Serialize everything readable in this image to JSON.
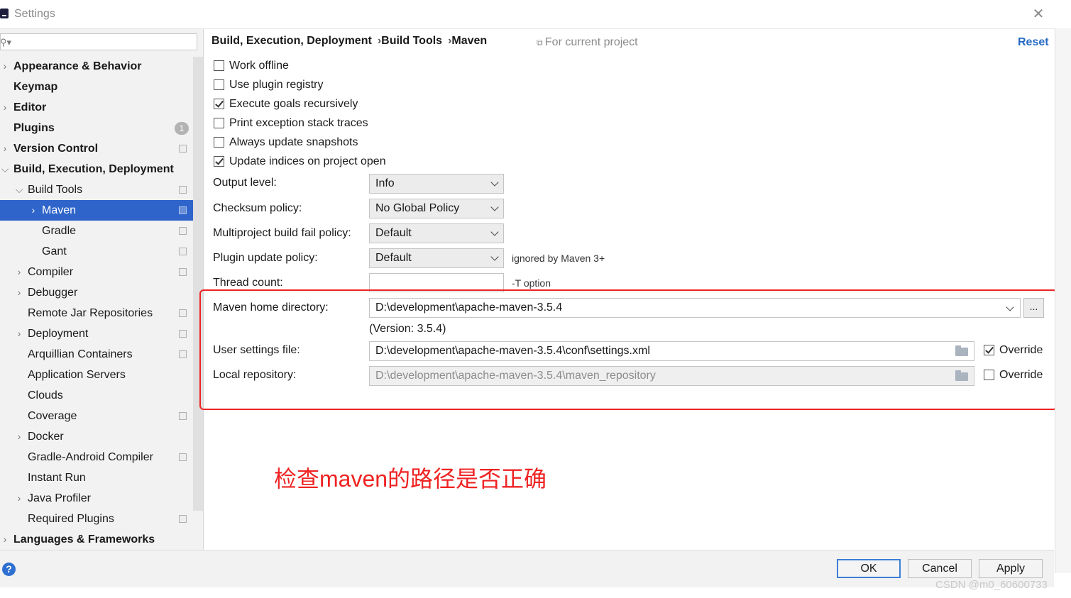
{
  "window": {
    "title": "Settings",
    "close_icon": "close-icon"
  },
  "search": {
    "placeholder": ""
  },
  "tree": [
    {
      "label": "Appearance & Behavior",
      "bold": true,
      "arrow": "›",
      "indent": 0,
      "proj": false
    },
    {
      "label": "Keymap",
      "bold": true,
      "arrow": "",
      "indent": 0,
      "proj": false
    },
    {
      "label": "Editor",
      "bold": true,
      "arrow": "›",
      "indent": 0,
      "proj": false
    },
    {
      "label": "Plugins",
      "bold": true,
      "arrow": "",
      "indent": 0,
      "proj": false,
      "badge": "1"
    },
    {
      "label": "Version Control",
      "bold": true,
      "arrow": "›",
      "indent": 0,
      "proj": true
    },
    {
      "label": "Build, Execution, Deployment",
      "bold": true,
      "arrow": "⌄",
      "indent": 0,
      "proj": false
    },
    {
      "label": "Build Tools",
      "bold": false,
      "arrow": "⌄",
      "indent": 1,
      "proj": true
    },
    {
      "label": "Maven",
      "bold": false,
      "arrow": "›",
      "indent": 2,
      "proj": true,
      "selected": true
    },
    {
      "label": "Gradle",
      "bold": false,
      "arrow": "",
      "indent": 2,
      "proj": true
    },
    {
      "label": "Gant",
      "bold": false,
      "arrow": "",
      "indent": 2,
      "proj": true
    },
    {
      "label": "Compiler",
      "bold": false,
      "arrow": "›",
      "indent": 1,
      "proj": true
    },
    {
      "label": "Debugger",
      "bold": false,
      "arrow": "›",
      "indent": 1,
      "proj": false
    },
    {
      "label": "Remote Jar Repositories",
      "bold": false,
      "arrow": "",
      "indent": 1,
      "proj": true
    },
    {
      "label": "Deployment",
      "bold": false,
      "arrow": "›",
      "indent": 1,
      "proj": true
    },
    {
      "label": "Arquillian Containers",
      "bold": false,
      "arrow": "",
      "indent": 1,
      "proj": true
    },
    {
      "label": "Application Servers",
      "bold": false,
      "arrow": "",
      "indent": 1,
      "proj": false
    },
    {
      "label": "Clouds",
      "bold": false,
      "arrow": "",
      "indent": 1,
      "proj": false
    },
    {
      "label": "Coverage",
      "bold": false,
      "arrow": "",
      "indent": 1,
      "proj": true
    },
    {
      "label": "Docker",
      "bold": false,
      "arrow": "›",
      "indent": 1,
      "proj": false
    },
    {
      "label": "Gradle-Android Compiler",
      "bold": false,
      "arrow": "",
      "indent": 1,
      "proj": true
    },
    {
      "label": "Instant Run",
      "bold": false,
      "arrow": "",
      "indent": 1,
      "proj": false
    },
    {
      "label": "Java Profiler",
      "bold": false,
      "arrow": "›",
      "indent": 1,
      "proj": false
    },
    {
      "label": "Required Plugins",
      "bold": false,
      "arrow": "",
      "indent": 1,
      "proj": true
    },
    {
      "label": "Languages & Frameworks",
      "bold": true,
      "arrow": "›",
      "indent": 0,
      "proj": false
    }
  ],
  "breadcrumb": {
    "part1": "Build, Execution, Deployment",
    "sep": "›",
    "part2": "Build Tools",
    "part3": "Maven"
  },
  "for_project": "For current project",
  "reset": "Reset",
  "checkboxes": [
    {
      "label": "Work offline",
      "checked": false
    },
    {
      "label": "Use plugin registry",
      "checked": false
    },
    {
      "label": "Execute goals recursively",
      "checked": true
    },
    {
      "label": "Print exception stack traces",
      "checked": false
    },
    {
      "label": "Always update snapshots",
      "checked": false
    },
    {
      "label": "Update indices on project open",
      "checked": true
    }
  ],
  "form": {
    "output_level_label": "Output level:",
    "output_level_value": "Info",
    "checksum_label": "Checksum policy:",
    "checksum_value": "No Global Policy",
    "multiproject_label": "Multiproject build fail policy:",
    "multiproject_value": "Default",
    "plugin_update_label": "Plugin update policy:",
    "plugin_update_value": "Default",
    "plugin_update_hint": "ignored by Maven 3+",
    "thread_count_label": "Thread count:",
    "thread_count_value": "",
    "thread_count_hint": "-T option",
    "maven_home_label": "Maven home directory:",
    "maven_home_value": "D:\\development\\apache-maven-3.5.4",
    "browse": "...",
    "version": "(Version: 3.5.4)",
    "settings_label": "User settings file:",
    "settings_value": "D:\\development\\apache-maven-3.5.4\\conf\\settings.xml",
    "settings_override": "Override",
    "settings_override_checked": true,
    "repo_label": "Local repository:",
    "repo_value": "D:\\development\\apache-maven-3.5.4\\maven_repository",
    "repo_override": "Override",
    "repo_override_checked": false
  },
  "annotation": "检查maven的路径是否正确",
  "buttons": {
    "ok": "OK",
    "cancel": "Cancel",
    "apply": "Apply",
    "help": "?"
  },
  "watermark": "CSDN @m0_60600733",
  "colors": {
    "selection": "#2f65ca",
    "annotation_red": "#ef2323",
    "link_blue": "#2469c3"
  }
}
